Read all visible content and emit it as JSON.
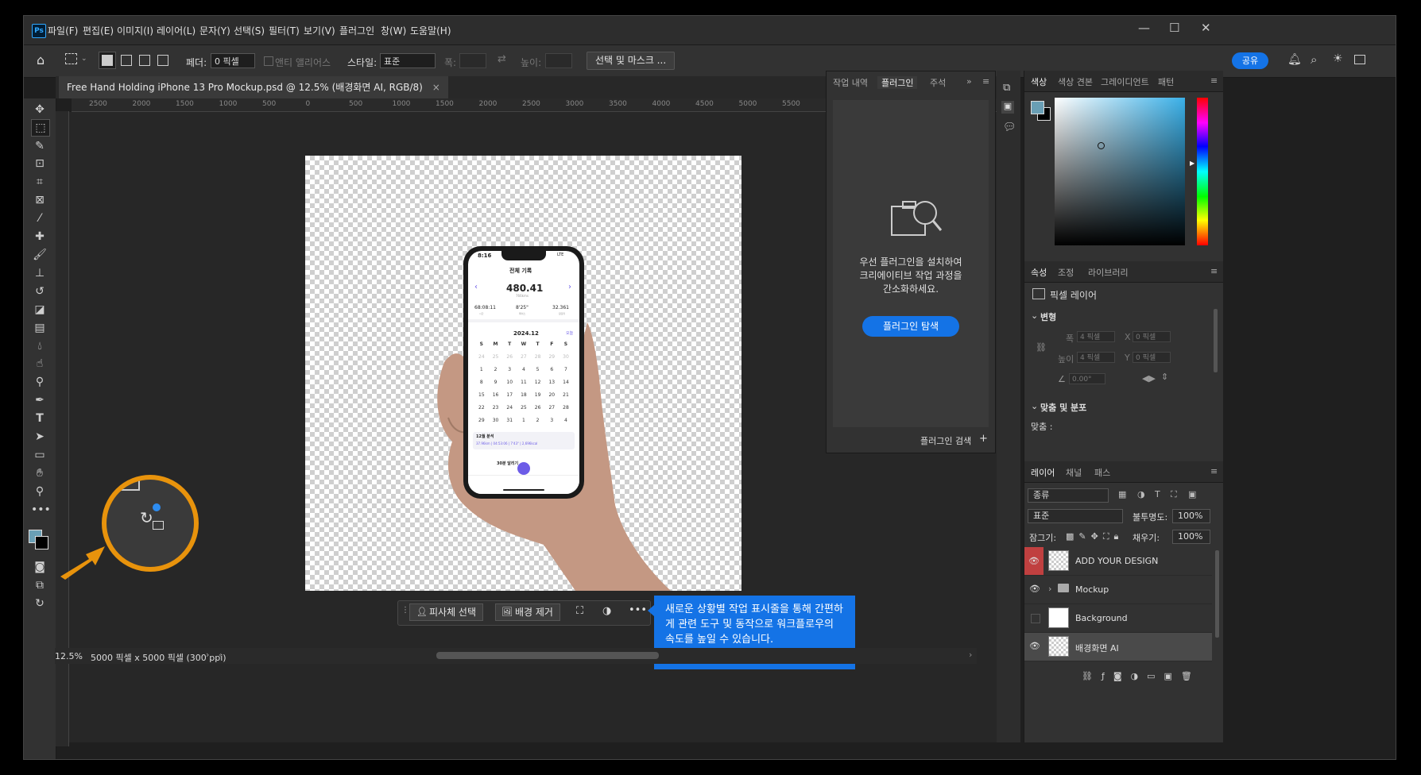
{
  "app": {
    "logo": "Ps"
  },
  "menu": [
    "파일(F)",
    "편집(E)",
    "이미지(I)",
    "레이어(L)",
    "문자(Y)",
    "선택(S)",
    "필터(T)",
    "보기(V)",
    "플러그인",
    "창(W)",
    "도움말(H)"
  ],
  "options": {
    "feather_label": "페더:",
    "feather_value": "0 픽셀",
    "antialias_label": "앤티 앨리어스",
    "style_label": "스타일:",
    "style_value": "표준",
    "width_label": "폭:",
    "height_label": "높이:",
    "select_mask_label": "선택 및 마스크 ...",
    "share_label": "공유"
  },
  "document": {
    "tab_title": "Free Hand Holding iPhone 13 Pro Mockup.psd @ 12.5% (배경화면 AI, RGB/8)",
    "close_glyph": "×",
    "ruler_marks": [
      "2500",
      "2000",
      "1500",
      "1000",
      "500",
      "0",
      "500",
      "1000",
      "1500",
      "2000",
      "2500",
      "3000",
      "3500",
      "4000",
      "4500",
      "5000",
      "5500"
    ],
    "zoom": "12.5%",
    "doc_info": "5000 픽셀 x 5000 픽셀 (300 ppi)"
  },
  "phone_screen": {
    "time": "8:16",
    "status": "LTE",
    "header": "전체 기록",
    "total": "480.41",
    "total_unit": "766kms",
    "stats": [
      "68:08:11",
      "8'25\"",
      "32.361"
    ],
    "stat_labels": [
      "시간",
      "페이스",
      "칼로리"
    ],
    "month": "2024.12",
    "today": "오늘",
    "weekdays": [
      "S",
      "M",
      "T",
      "W",
      "T",
      "F",
      "S"
    ],
    "weeks": [
      [
        "24",
        "25",
        "26",
        "27",
        "28",
        "29",
        "30"
      ],
      [
        "1",
        "2",
        "3",
        "4",
        "5",
        "6",
        "7"
      ],
      [
        "8",
        "9",
        "10",
        "11",
        "12",
        "13",
        "14"
      ],
      [
        "15",
        "16",
        "17",
        "18",
        "19",
        "20",
        "21"
      ],
      [
        "22",
        "23",
        "24",
        "25",
        "26",
        "27",
        "28"
      ],
      [
        "29",
        "30",
        "31",
        "1",
        "2",
        "3",
        "4"
      ]
    ],
    "summary_title": "12월 분석",
    "summary_text": "37.96km | 04:53:06 | 7'43\" | 2,696kcal",
    "bottom_title": "30분 달리기"
  },
  "context_bar": {
    "subject_label": "피사체 선택",
    "remove_bg_label": "배경 제거"
  },
  "tooltip": {
    "text": "새로운 상황별 작업 표시줄을 통해 간편하게 관련 도구 및 동작으로 워크플로우의 속도를 높일 수 있습니다."
  },
  "plugins_panel": {
    "tabs": [
      "작업 내역",
      "플러그인",
      "주석"
    ],
    "message": "우선 플러그인을 설치하여 크리에이티브 작업 과정을 간소화하세요.",
    "browse_button": "플러그인 탐색",
    "search_label": "플러그인 검색",
    "search_plus": "+"
  },
  "color_panel": {
    "tabs": [
      "색상",
      "색상 견본",
      "그레이디언트",
      "패턴"
    ],
    "foreground": "#6a9fb5",
    "background": "#000000"
  },
  "properties_panel": {
    "tabs": [
      "속성",
      "조정",
      "라이브러리"
    ],
    "type_label": "픽셀 레이어",
    "transform_label": "변형",
    "w_label": "폭",
    "h_label": "높이",
    "w_value": "4 픽셀",
    "h_value": "4 픽셀",
    "x_label": "X",
    "y_label": "Y",
    "x_value": "0 픽셀",
    "y_value": "0 픽셀",
    "angle_value": "0.00°",
    "align_label": "맞춤 및 분포",
    "align_sub": "맞춤 :"
  },
  "layers_panel": {
    "tabs": [
      "레이어",
      "채널",
      "패스"
    ],
    "filter_value": "종류",
    "blend_mode": "표준",
    "opacity_label": "불투명도:",
    "opacity_value": "100%",
    "lock_label": "잠그기:",
    "fill_label": "채우기:",
    "fill_value": "100%",
    "layers": [
      {
        "name": "ADD YOUR DESIGN",
        "visible": true
      },
      {
        "name": "Mockup",
        "visible": true
      },
      {
        "name": "Background",
        "visible": false
      },
      {
        "name": "배경화면 AI",
        "visible": true
      }
    ]
  },
  "accent": {
    "blue": "#1473e6",
    "orange": "#e8930c",
    "purple": "#6c5ce7"
  }
}
